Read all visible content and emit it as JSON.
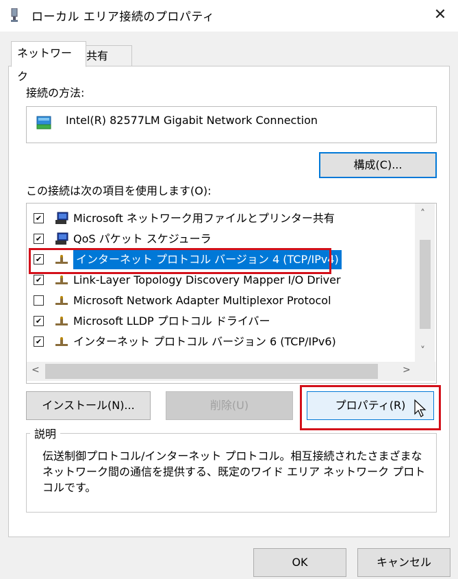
{
  "window": {
    "title": "ローカル エリア接続のプロパティ",
    "close_glyph": "✕"
  },
  "tabs": [
    {
      "label": "ネットワーク",
      "active": true
    },
    {
      "label": "共有",
      "active": false
    }
  ],
  "connection": {
    "label": "接続の方法:",
    "adapter_name": "Intel(R) 82577LM Gigabit Network Connection",
    "configure_button": "構成(C)..."
  },
  "items_section": {
    "label": "この接続は次の項目を使用します(O):",
    "items": [
      {
        "checked": true,
        "icon": "network-client-icon",
        "label": "Microsoft ネットワーク用ファイルとプリンター共有"
      },
      {
        "checked": true,
        "icon": "network-client-icon",
        "label": "QoS パケット スケジューラ"
      },
      {
        "checked": true,
        "icon": "protocol-icon",
        "label": "インターネット プロトコル バージョン 4 (TCP/IPv4)",
        "selected": true
      },
      {
        "checked": true,
        "icon": "protocol-icon",
        "label": "Link-Layer Topology Discovery Mapper I/O Driver"
      },
      {
        "checked": false,
        "icon": "protocol-icon",
        "label": "Microsoft Network Adapter Multiplexor Protocol"
      },
      {
        "checked": true,
        "icon": "protocol-icon",
        "label": "Microsoft LLDP プロトコル ドライバー"
      },
      {
        "checked": true,
        "icon": "protocol-icon",
        "label": "インターネット プロトコル バージョン 6 (TCP/IPv6)"
      }
    ],
    "check_glyph": "✔"
  },
  "buttons": {
    "install": "インストール(N)...",
    "uninstall": "削除(U)",
    "properties": "プロパティ(R)",
    "ok": "OK",
    "cancel": "キャンセル"
  },
  "description": {
    "title": "説明",
    "text": "伝送制御プロトコル/インターネット プロトコル。相互接続されたさまざまなネットワーク間の通信を提供する、既定のワイド エリア ネットワーク プロトコルです。"
  },
  "scroll_glyphs": {
    "up": "˄",
    "down": "˅",
    "left": "<",
    "right": ">"
  },
  "colors": {
    "selection": "#0078d7",
    "highlight_box": "#d3101a",
    "focus_border": "#0078d7"
  }
}
